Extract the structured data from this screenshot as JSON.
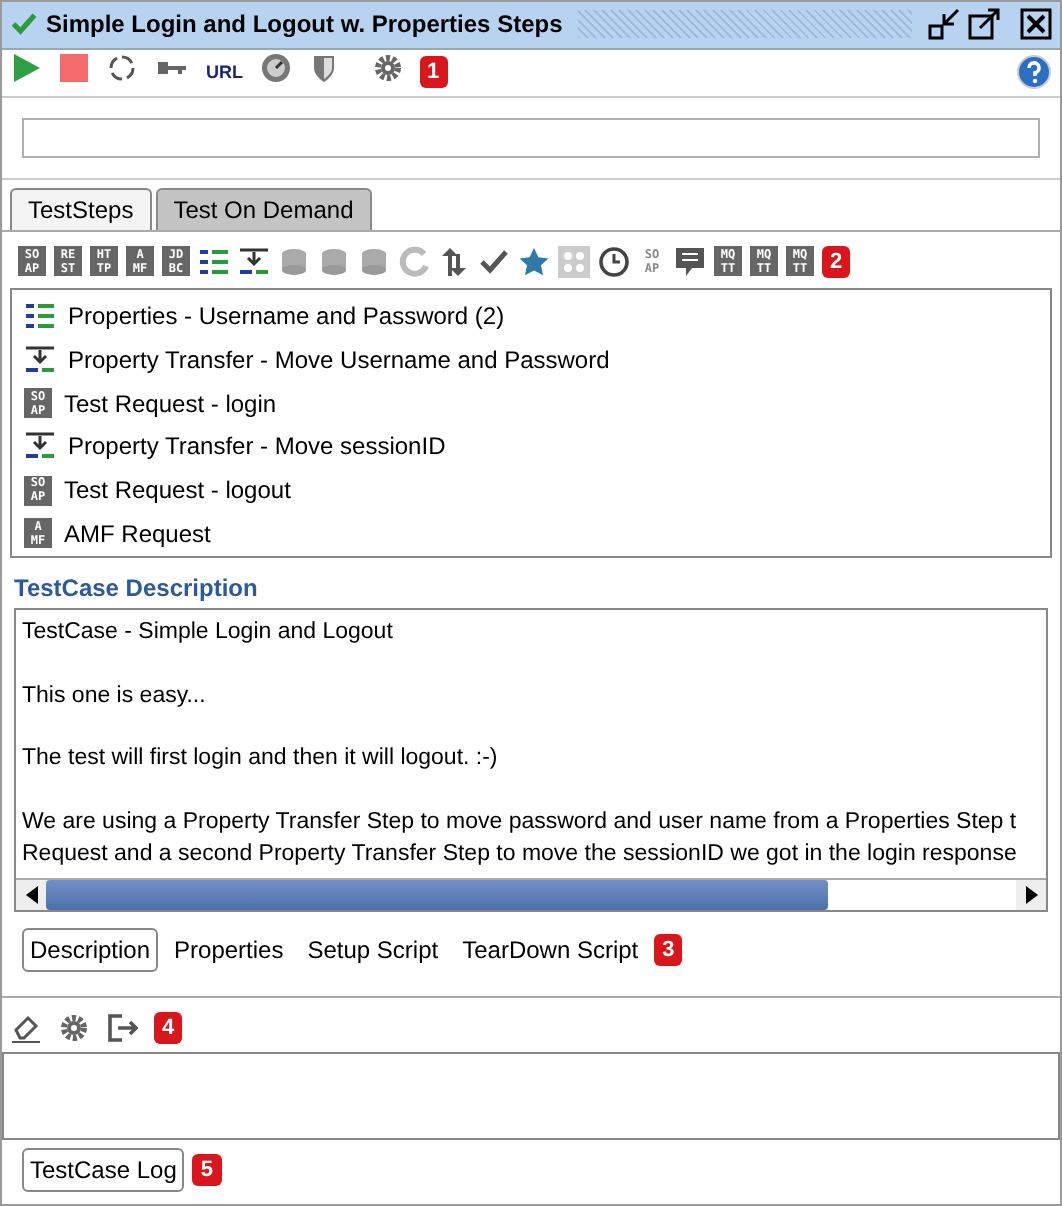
{
  "window": {
    "title": "Simple Login and Logout w. Properties Steps"
  },
  "toolbar": {
    "items": [
      {
        "kind": "run"
      },
      {
        "kind": "stop"
      },
      {
        "kind": "loop"
      },
      {
        "kind": "key"
      },
      {
        "kind": "text",
        "text": "URL"
      },
      {
        "kind": "gauge"
      },
      {
        "kind": "shield"
      },
      {
        "kind": "gear"
      },
      {
        "kind": "badge",
        "text": "1"
      }
    ]
  },
  "tabs": [
    {
      "label": "TestSteps",
      "selected": true
    },
    {
      "label": "Test On Demand",
      "selected": false
    }
  ],
  "step_toolbar": [
    {
      "kind": "letters",
      "lines": [
        "SO",
        "AP"
      ]
    },
    {
      "kind": "letters",
      "lines": [
        "RE",
        "ST"
      ]
    },
    {
      "kind": "letters",
      "lines": [
        "HT",
        "TP"
      ]
    },
    {
      "kind": "letters",
      "lines": [
        "A",
        "MF"
      ]
    },
    {
      "kind": "letters",
      "lines": [
        "JD",
        "BC"
      ]
    },
    {
      "kind": "properties"
    },
    {
      "kind": "transfer"
    },
    {
      "kind": "db"
    },
    {
      "kind": "db"
    },
    {
      "kind": "db"
    },
    {
      "kind": "refresh"
    },
    {
      "kind": "arrows"
    },
    {
      "kind": "check"
    },
    {
      "kind": "star"
    },
    {
      "kind": "grid"
    },
    {
      "kind": "clock"
    },
    {
      "kind": "faded",
      "lines": [
        "SO",
        "AP"
      ]
    },
    {
      "kind": "comment"
    },
    {
      "kind": "letters",
      "lines": [
        "MQ",
        "TT"
      ]
    },
    {
      "kind": "letters",
      "lines": [
        "MQ",
        "TT"
      ]
    },
    {
      "kind": "letters",
      "lines": [
        "MQ",
        "TT"
      ]
    },
    {
      "kind": "badge",
      "text": "2"
    }
  ],
  "steps": [
    {
      "kind": "properties",
      "label": "Properties - Username and Password (2)"
    },
    {
      "kind": "transfer",
      "label": "Property Transfer - Move Username and Password"
    },
    {
      "kind": "letters",
      "lines": [
        "SO",
        "AP"
      ],
      "label": "Test Request - login"
    },
    {
      "kind": "transfer",
      "label": "Property Transfer - Move sessionID"
    },
    {
      "kind": "letters",
      "lines": [
        "SO",
        "AP"
      ],
      "label": "Test Request - logout"
    },
    {
      "kind": "letters",
      "lines": [
        "A",
        "MF"
      ],
      "label": "AMF Request"
    }
  ],
  "description": {
    "heading": "TestCase Description",
    "paragraphs": [
      [
        "TestCase - Simple Login and Logout"
      ],
      [
        "This one is easy..."
      ],
      [
        "The test will first login and then it will logout. :-)"
      ],
      [
        "We are using a Property Transfer Step to move password and user name from a Properties Step t",
        "Request and a second Property Transfer Step to move the sessionID we got in the login response"
      ]
    ]
  },
  "detail_tabs": [
    {
      "label": "Description",
      "selected": true
    },
    {
      "label": "Properties",
      "selected": false
    },
    {
      "label": "Setup Script",
      "selected": false
    },
    {
      "label": "TearDown Script",
      "selected": false
    }
  ],
  "detail_badge": "3",
  "log_toolbar": {
    "badge": "4"
  },
  "log_tabs": [
    {
      "label": "TestCase Log",
      "selected": true
    }
  ],
  "log_badge": "5"
}
